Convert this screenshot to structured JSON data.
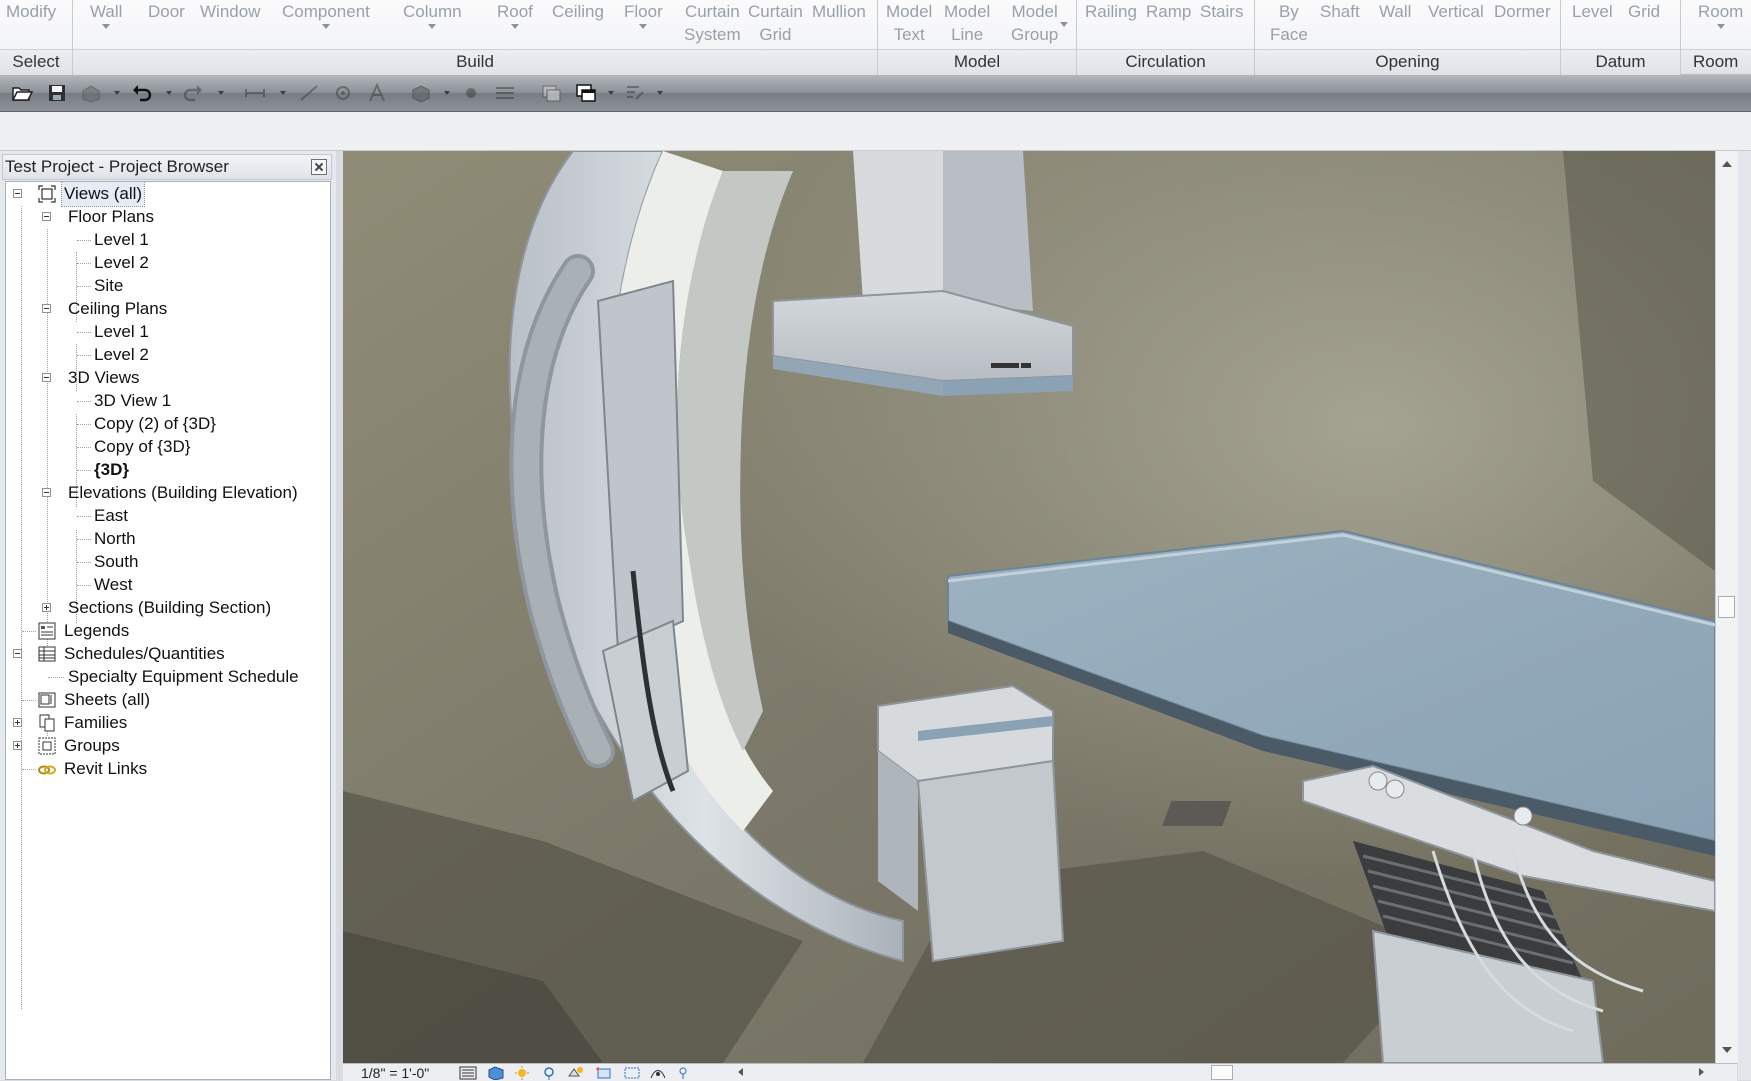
{
  "ribbon": {
    "buttons": {
      "modify": "Modify",
      "wall": "Wall",
      "door": "Door",
      "window": "Window",
      "component": "Component",
      "column": "Column",
      "roof": "Roof",
      "ceiling": "Ceiling",
      "floor": "Floor",
      "curtain_system_1": "Curtain",
      "curtain_system_2": "System",
      "curtain_grid_1": "Curtain",
      "curtain_grid_2": "Grid",
      "mullion": "Mullion",
      "model_text_1": "Model",
      "model_text_2": "Text",
      "model_line_1": "Model",
      "model_line_2": "Line",
      "model_group_1": "Model",
      "model_group_2": "Group",
      "railing": "Railing",
      "ramp": "Ramp",
      "stairs": "Stairs",
      "by_face_1": "By",
      "by_face_2": "Face",
      "shaft": "Shaft",
      "opening_wall": "Wall",
      "vertical": "Vertical",
      "dormer": "Dormer",
      "level": "Level",
      "grid": "Grid",
      "room": "Room"
    },
    "groups": {
      "select": "Select",
      "build": "Build",
      "model": "Model",
      "circulation": "Circulation",
      "opening": "Opening",
      "datum": "Datum",
      "room": "Room"
    }
  },
  "project_browser": {
    "title": "Test Project - Project Browser",
    "tree": {
      "views_all": "Views (all)",
      "floor_plans": "Floor Plans",
      "fp_level1": "Level 1",
      "fp_level2": "Level 2",
      "fp_site": "Site",
      "ceiling_plans": "Ceiling Plans",
      "cp_level1": "Level 1",
      "cp_level2": "Level 2",
      "views_3d": "3D Views",
      "view_3d_1": "3D View 1",
      "copy2_3d": "Copy (2) of {3D}",
      "copy_3d": "Copy of {3D}",
      "view_3d_default": "{3D}",
      "elevations": "Elevations (Building Elevation)",
      "east": "East",
      "north": "North",
      "south": "South",
      "west": "West",
      "sections": "Sections (Building Section)",
      "legends": "Legends",
      "schedules": "Schedules/Quantities",
      "specialty_schedule": "Specialty Equipment Schedule",
      "sheets": "Sheets (all)",
      "families": "Families",
      "groups": "Groups",
      "revit_links": "Revit Links"
    }
  },
  "view_control_bar": {
    "scale": "1/8\" = 1'-0\""
  },
  "colors": {
    "ribbon_text_disabled": "#9aa0a8",
    "toolbar_dark": "#8d9299",
    "tree_selection": "#e5ecf6",
    "floor": "#7e7a66"
  }
}
